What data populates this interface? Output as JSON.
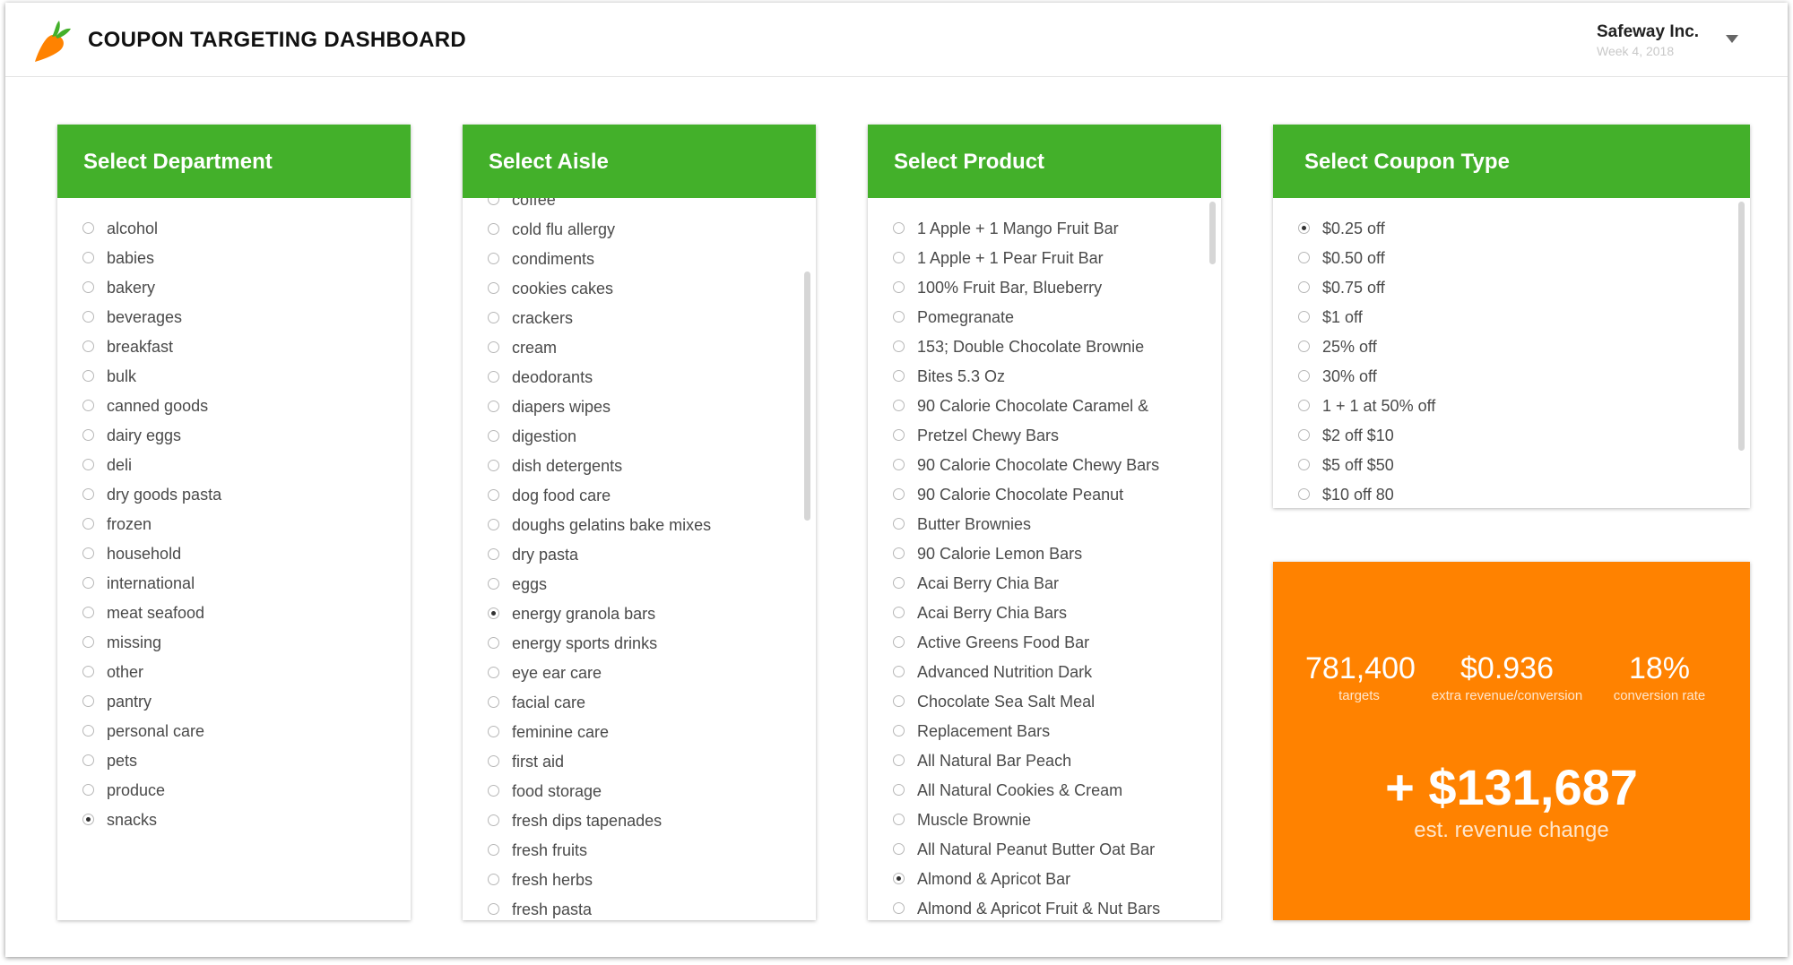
{
  "app": {
    "title": "COUPON TARGETING DASHBOARD"
  },
  "account": {
    "name": "Safeway Inc.",
    "week": "Week 4, 2018"
  },
  "colors": {
    "brand_green": "#43b02a",
    "stats_orange": "#ff8200",
    "carrot_orange": "#ff8200",
    "carrot_leaf": "#43b02a"
  },
  "icons": {
    "logo": "carrot-logo-icon",
    "account_menu": "chevron-down-icon",
    "radio": "radio-button-icon"
  },
  "department": {
    "title": "Select Department",
    "selected": "snacks",
    "options": [
      "alcohol",
      "babies",
      "bakery",
      "beverages",
      "breakfast",
      "bulk",
      "canned goods",
      "dairy eggs",
      "deli",
      "dry goods pasta",
      "frozen",
      "household",
      "international",
      "meat seafood",
      "missing",
      "other",
      "pantry",
      "personal care",
      "pets",
      "produce",
      "snacks"
    ]
  },
  "aisle": {
    "title": "Select Aisle",
    "selected": "energy granola bars",
    "options": [
      "coffee",
      "cold flu allergy",
      "condiments",
      "cookies cakes",
      "crackers",
      "cream",
      "deodorants",
      "diapers wipes",
      "digestion",
      "dish detergents",
      "dog food care",
      "doughs gelatins bake mixes",
      "dry pasta",
      "eggs",
      "energy granola bars",
      "energy sports drinks",
      "eye ear care",
      "facial care",
      "feminine care",
      "first aid",
      "food storage",
      "fresh dips tapenades",
      "fresh fruits",
      "fresh herbs",
      "fresh pasta"
    ]
  },
  "product": {
    "title": "Select Product",
    "selected": "Almond & Apricot Bar",
    "options": [
      "1 Apple + 1 Mango Fruit Bar",
      "1 Apple + 1 Pear Fruit Bar",
      "100% Fruit Bar, Blueberry",
      "Pomegranate",
      "153; Double Chocolate Brownie",
      "Bites 5.3 Oz",
      "90 Calorie Chocolate Caramel &",
      "Pretzel Chewy Bars",
      "90 Calorie Chocolate Chewy Bars",
      "90 Calorie Chocolate Peanut",
      "Butter Brownies",
      "90 Calorie Lemon Bars",
      "Acai Berry Chia Bar",
      "Acai Berry Chia Bars",
      "Active Greens Food Bar",
      "Advanced Nutrition Dark",
      "Chocolate Sea Salt Meal",
      "Replacement Bars",
      "All Natural Bar Peach",
      "All Natural Cookies & Cream",
      "Muscle Brownie",
      "All Natural Peanut Butter Oat Bar",
      "Almond & Apricot Bar",
      "Almond & Apricot Fruit & Nut Bars"
    ]
  },
  "coupon": {
    "title": "Select Coupon Type",
    "selected": "$0.25 off",
    "options": [
      "$0.25 off",
      "$0.50 off",
      "$0.75 off",
      "$1 off",
      "25% off",
      "30% off",
      "1 + 1 at 50% off",
      "$2 off $10",
      "$5 off $50",
      "$10 off 80"
    ]
  },
  "stats": {
    "targets": {
      "value": "781,400",
      "label": "targets"
    },
    "extra_revenue": {
      "value": "$0.936",
      "label": "extra revenue/conversion"
    },
    "conversion": {
      "value": "18%",
      "label": "conversion rate"
    },
    "revenue_change": {
      "value": "+ $131,687",
      "label": "est. revenue change"
    }
  }
}
